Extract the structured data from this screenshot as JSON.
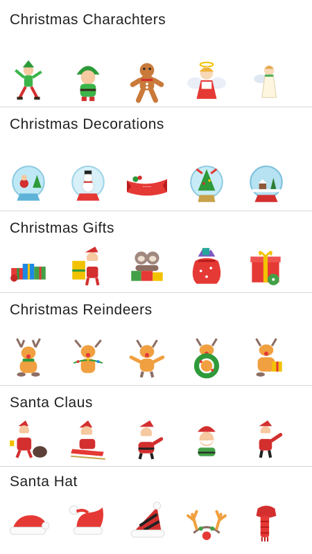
{
  "packs": [
    {
      "title": "Christmas Charachters",
      "stickers": [
        "elf-dancing-icon",
        "elf-standing-icon",
        "gingerbread-man-icon",
        "angel-girl-icon",
        "angel-small-icon"
      ]
    },
    {
      "title": "Christmas Decorations",
      "stickers": [
        "snow-globe-santa-icon",
        "snow-globe-snowman-icon",
        "ribbon-banner-icon",
        "snow-globe-tree-icon",
        "snow-globe-village-icon"
      ]
    },
    {
      "title": "Christmas Gifts",
      "stickers": [
        "gift-pile-icon",
        "santa-with-gifts-icon",
        "sloths-with-gifts-icon",
        "gift-sack-icon",
        "gift-box-icon"
      ]
    },
    {
      "title": "Christmas Reindeers",
      "stickers": [
        "reindeer-sitting-icon",
        "reindeer-lights-icon",
        "reindeer-waving-icon",
        "reindeer-wreath-icon",
        "reindeer-gift-icon"
      ]
    },
    {
      "title": "Santa Claus",
      "stickers": [
        "santa-with-sack-icon",
        "santa-on-sled-icon",
        "santa-thumbs-up-icon",
        "santa-elf-face-icon",
        "santa-pointing-icon"
      ]
    },
    {
      "title": "Santa Hat",
      "stickers": [
        "santa-hat-icon",
        "santa-hat-curly-icon",
        "striped-hat-icon",
        "reindeer-antlers-headband-icon",
        "scarf-icon"
      ]
    }
  ]
}
